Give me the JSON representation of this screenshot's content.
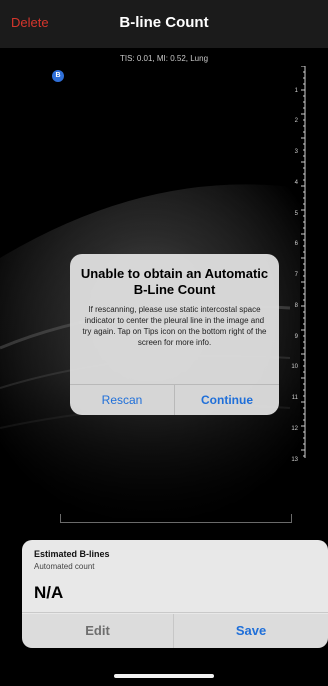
{
  "nav": {
    "delete_label": "Delete",
    "title": "B-line Count"
  },
  "scan": {
    "info": "TIS: 0.01, MI: 0.52, Lung",
    "probe_marker": "B",
    "depth_labels": [
      "1",
      "2",
      "3",
      "4",
      "5",
      "6",
      "7",
      "8",
      "9",
      "10",
      "11",
      "12",
      "13"
    ]
  },
  "dialog": {
    "title": "Unable to obtain an Automatic B-Line Count",
    "message": "If rescanning, please use static intercostal space indicator to center the pleural line in the image and try again. Tap on Tips icon on the bottom right of the screen for more info.",
    "rescan_label": "Rescan",
    "continue_label": "Continue"
  },
  "result": {
    "title": "Estimated B-lines",
    "subtitle": "Automated count",
    "value": "N/A",
    "edit_label": "Edit",
    "save_label": "Save"
  },
  "colors": {
    "accent": "#1f6fd9",
    "destructive": "#d5362c"
  }
}
